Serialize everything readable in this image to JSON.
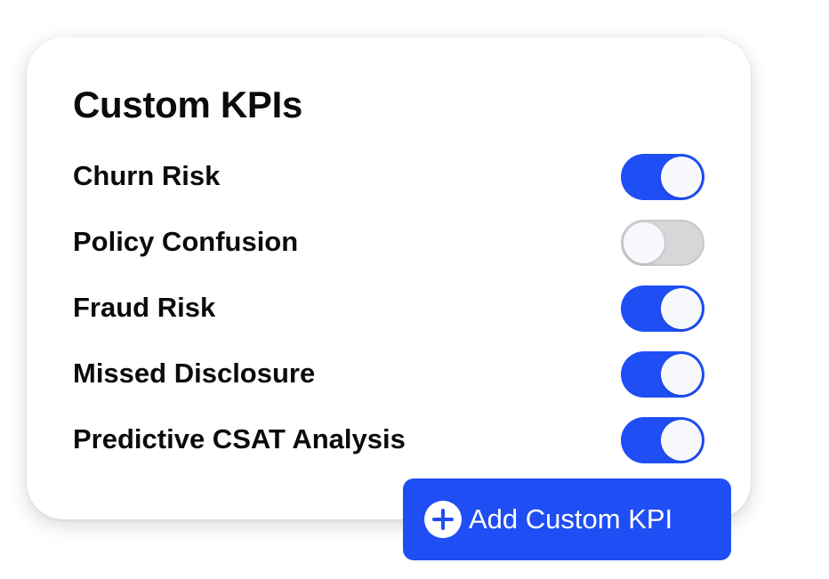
{
  "card": {
    "title": "Custom KPIs"
  },
  "kpis": [
    {
      "label": "Churn Risk",
      "enabled": true
    },
    {
      "label": "Policy Confusion",
      "enabled": false
    },
    {
      "label": "Fraud Risk",
      "enabled": true
    },
    {
      "label": "Missed Disclosure",
      "enabled": true
    },
    {
      "label": "Predictive CSAT Analysis",
      "enabled": true
    }
  ],
  "add_button": {
    "label": "Add Custom KPI",
    "icon": "plus-circle-icon"
  },
  "colors": {
    "accent": "#1f4ef5",
    "toggle_off": "#d7d7d9",
    "text": "#0b0b0b"
  }
}
